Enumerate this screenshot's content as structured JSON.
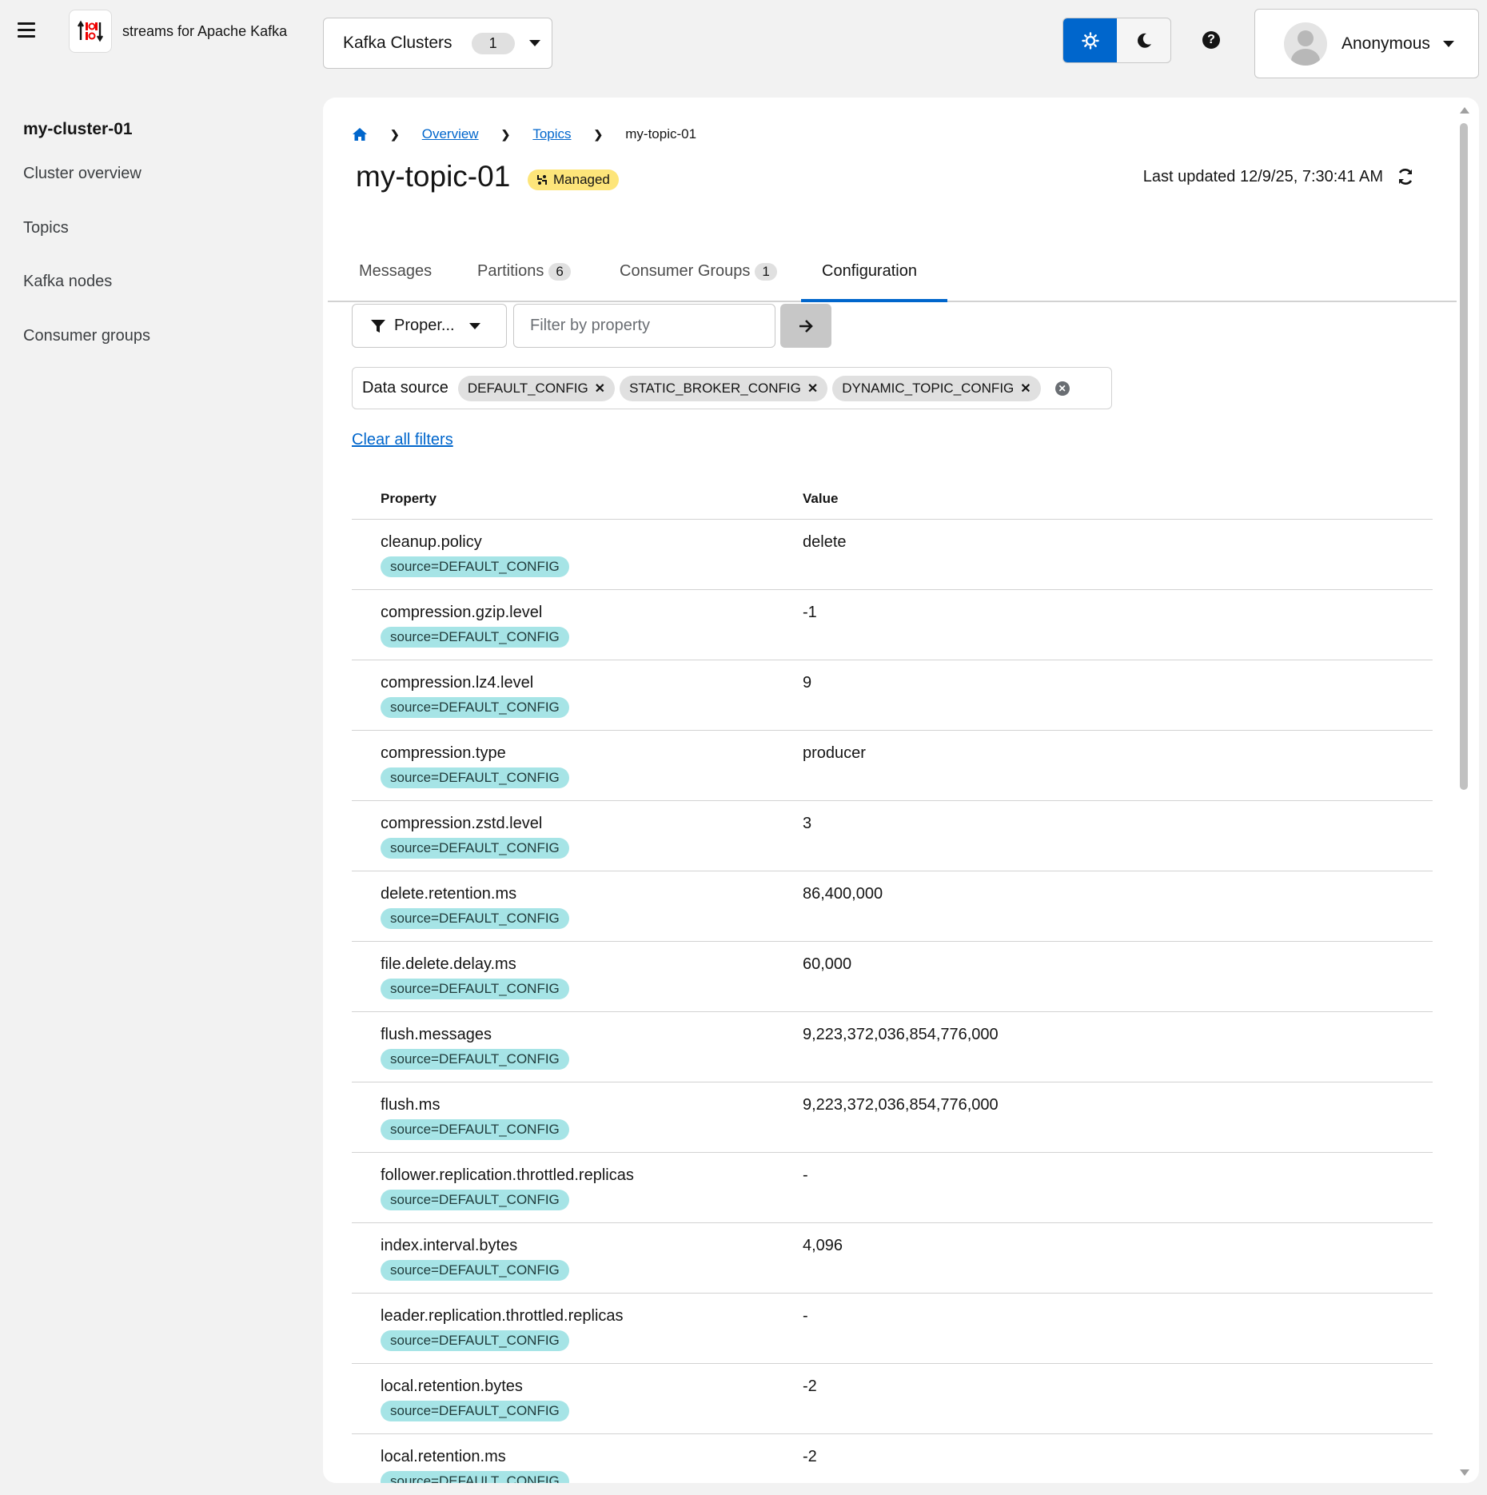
{
  "header": {
    "brand": "streams for Apache Kafka",
    "cluster_selector": {
      "label": "Kafka Clusters",
      "count": "1"
    },
    "user": "Anonymous"
  },
  "sidebar": {
    "cluster_name": "my-cluster-01",
    "items": [
      {
        "label": "Cluster overview"
      },
      {
        "label": "Topics"
      },
      {
        "label": "Kafka nodes"
      },
      {
        "label": "Consumer groups"
      }
    ]
  },
  "breadcrumb": {
    "overview": "Overview",
    "topics": "Topics",
    "current": "my-topic-01"
  },
  "page": {
    "title": "my-topic-01",
    "managed_badge": "Managed",
    "last_updated": "Last updated 12/9/25, 7:30:41 AM"
  },
  "tabs": [
    {
      "label": "Messages"
    },
    {
      "label": "Partitions",
      "badge": "6"
    },
    {
      "label": "Consumer Groups",
      "badge": "1"
    },
    {
      "label": "Configuration"
    }
  ],
  "filter": {
    "select_label": "Proper...",
    "placeholder": "Filter by property",
    "chip_group_label": "Data source",
    "chips": [
      "DEFAULT_CONFIG",
      "STATIC_BROKER_CONFIG",
      "DYNAMIC_TOPIC_CONFIG"
    ],
    "clear_all": "Clear all filters"
  },
  "table": {
    "headers": {
      "property": "Property",
      "value": "Value"
    },
    "rows": [
      {
        "property": "cleanup.policy",
        "source": "source=DEFAULT_CONFIG",
        "value": "delete"
      },
      {
        "property": "compression.gzip.level",
        "source": "source=DEFAULT_CONFIG",
        "value": "-1"
      },
      {
        "property": "compression.lz4.level",
        "source": "source=DEFAULT_CONFIG",
        "value": "9"
      },
      {
        "property": "compression.type",
        "source": "source=DEFAULT_CONFIG",
        "value": "producer"
      },
      {
        "property": "compression.zstd.level",
        "source": "source=DEFAULT_CONFIG",
        "value": "3"
      },
      {
        "property": "delete.retention.ms",
        "source": "source=DEFAULT_CONFIG",
        "value": "86,400,000"
      },
      {
        "property": "file.delete.delay.ms",
        "source": "source=DEFAULT_CONFIG",
        "value": "60,000"
      },
      {
        "property": "flush.messages",
        "source": "source=DEFAULT_CONFIG",
        "value": "9,223,372,036,854,776,000"
      },
      {
        "property": "flush.ms",
        "source": "source=DEFAULT_CONFIG",
        "value": "9,223,372,036,854,776,000"
      },
      {
        "property": "follower.replication.throttled.replicas",
        "source": "source=DEFAULT_CONFIG",
        "value": "-"
      },
      {
        "property": "index.interval.bytes",
        "source": "source=DEFAULT_CONFIG",
        "value": "4,096"
      },
      {
        "property": "leader.replication.throttled.replicas",
        "source": "source=DEFAULT_CONFIG",
        "value": "-"
      },
      {
        "property": "local.retention.bytes",
        "source": "source=DEFAULT_CONFIG",
        "value": "-2"
      },
      {
        "property": "local.retention.ms",
        "source": "source=DEFAULT_CONFIG",
        "value": "-2"
      }
    ]
  },
  "colors": {
    "accent": "#0066cc",
    "managed_badge": "#fde57a",
    "source_label": "#a6e4e6"
  },
  "icons": [
    "hamburger-icon",
    "logo-icon",
    "caret-down-icon",
    "sun-icon",
    "moon-icon",
    "help-icon",
    "avatar-icon",
    "home-icon",
    "chevron-right-icon",
    "managed-icon",
    "refresh-icon",
    "filter-icon",
    "arrow-right-icon",
    "close-icon",
    "clear-circle-icon"
  ]
}
